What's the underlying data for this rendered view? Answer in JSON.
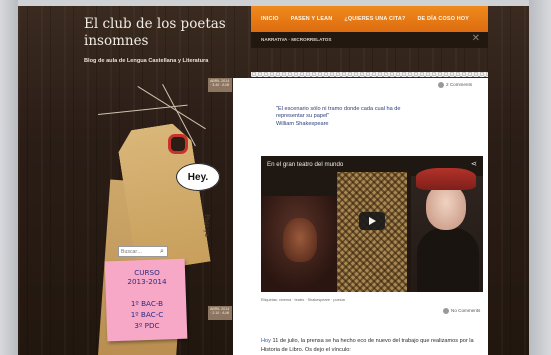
{
  "site": {
    "title": "El club de los poetas insomnes",
    "description": "Blog de aula de Lengua Castellana y Literatura"
  },
  "nav": {
    "items": [
      "INICIO",
      "PASEN Y LEAN",
      "¿QUIERES UNA CITA?",
      "DE DÍA COSO HOY"
    ],
    "subnav": "NARRATIVA · MICRORRELATOS"
  },
  "post1": {
    "meta": "ABRIL 2014 · 3:40 · A MI",
    "comments": "2 Comments",
    "quote_lines": [
      "\"El escenario sólo ni tramo donde cada cual ha de",
      "representar su papel\"",
      "William Shakespeare"
    ]
  },
  "video": {
    "title": "En el gran teatro del mundo"
  },
  "post2": {
    "footer": "Etiquetas: cinema · teatro · Shakespeare · poesía",
    "meta": "ABRIL 2014 · 2:10 · A MI",
    "comments": "No Comments",
    "text_pre": "Hoy",
    "text_rest": " 11 de julio, la prensa se ha hecho eco de nuevo del trabajo que realizamos por la Historia de Libro. Os dejo el vínculo:"
  },
  "sidebar": {
    "bubble": "Hey.",
    "tag_text": "Pasa ya",
    "search_placeholder": "Buscar…",
    "note_lines": [
      "CURSO",
      "2013-2014",
      "1º BAC-B",
      "1º BAC-C",
      "3º PDC"
    ]
  }
}
